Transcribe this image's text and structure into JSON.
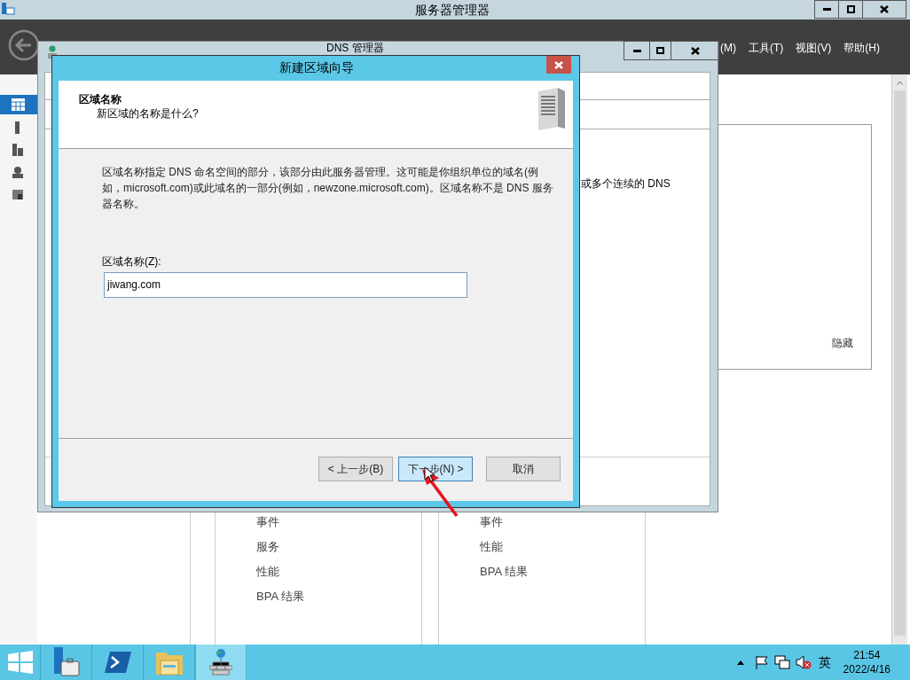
{
  "window": {
    "title": "服务器管理器"
  },
  "menu": [
    {
      "label": "(M)"
    },
    {
      "label": "工具(T)"
    },
    {
      "label": "视图(V)"
    },
    {
      "label": "帮助(H)"
    }
  ],
  "hide_link": "隐藏",
  "panels": [
    {
      "items": [
        "事件",
        "服务",
        "性能",
        "BPA 结果"
      ]
    },
    {
      "items": [
        "事件",
        "性能",
        "BPA 结果"
      ]
    }
  ],
  "dns_window": {
    "title": "DNS 管理器",
    "visible_text": "或多个连续的 DNS"
  },
  "wizard": {
    "title": "新建区域向导",
    "heading": "区域名称",
    "subheading": "新区域的名称是什么?",
    "description": "区域名称指定 DNS 命名空间的部分，该部分由此服务器管理。这可能是你组织单位的域名(例如，microsoft.com)或此域名的一部分(例如，newzone.microsoft.com)。区域名称不是 DNS 服务器名称。",
    "field_label": "区域名称(Z):",
    "field_value": "jiwang.com",
    "buttons": [
      {
        "label": "< 上一步(B)",
        "focused": false
      },
      {
        "label": "下一步(N) >",
        "focused": true
      },
      {
        "label": "取消",
        "focused": false
      }
    ]
  },
  "taskbar": {
    "items": [
      {
        "kind": "start",
        "selected": false
      },
      {
        "kind": "server-manager",
        "selected": false
      },
      {
        "kind": "powershell",
        "selected": false
      },
      {
        "kind": "explorer",
        "selected": false
      },
      {
        "kind": "dns",
        "selected": true
      }
    ],
    "tray_language": "英",
    "time": "21:54",
    "date": "2022/4/16"
  }
}
